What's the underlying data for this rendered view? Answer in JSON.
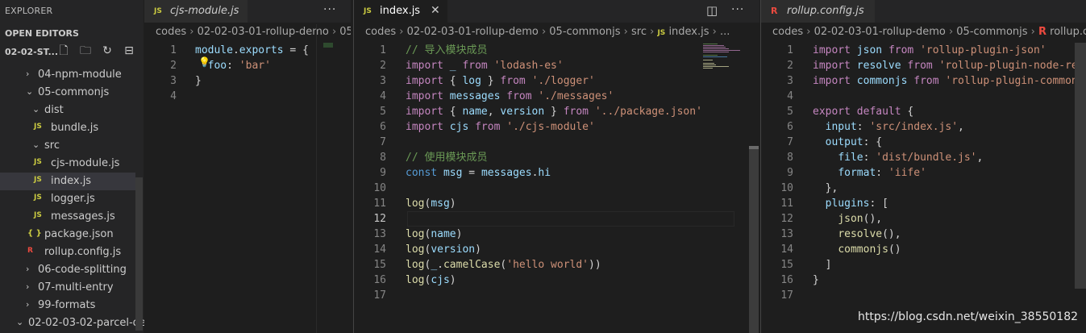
{
  "explorer": {
    "title": "EXPLORER",
    "more": "···",
    "open_editors": "OPEN EDITORS",
    "workspace": "02-02-ST...",
    "tree": [
      {
        "label": "04-npm-module",
        "type": "folder",
        "state": "collapsed",
        "depth": 1
      },
      {
        "label": "05-commonjs",
        "type": "folder",
        "state": "expanded",
        "depth": 1
      },
      {
        "label": "dist",
        "type": "folder",
        "state": "expanded",
        "depth": 2
      },
      {
        "label": "bundle.js",
        "type": "js",
        "depth": 3
      },
      {
        "label": "src",
        "type": "folder",
        "state": "expanded",
        "depth": 2
      },
      {
        "label": "cjs-module.js",
        "type": "js",
        "depth": 3
      },
      {
        "label": "index.js",
        "type": "js",
        "depth": 3,
        "selected": true
      },
      {
        "label": "logger.js",
        "type": "js",
        "depth": 3
      },
      {
        "label": "messages.js",
        "type": "js",
        "depth": 3
      },
      {
        "label": "package.json",
        "type": "json",
        "depth": 2
      },
      {
        "label": "rollup.config.js",
        "type": "rollup",
        "depth": 2
      },
      {
        "label": "06-code-splitting",
        "type": "folder",
        "state": "collapsed",
        "depth": 1
      },
      {
        "label": "07-multi-entry",
        "type": "folder",
        "state": "collapsed",
        "depth": 1
      },
      {
        "label": "99-formats",
        "type": "folder",
        "state": "collapsed",
        "depth": 1
      },
      {
        "label": "02-02-03-02-parcel-de...",
        "type": "folder",
        "state": "expanded",
        "depth": 0
      }
    ],
    "icons": {
      "js": "JS",
      "json": "{ }",
      "rollup": "R",
      "collapsed": "›",
      "expanded": "⌄"
    }
  },
  "editors": [
    {
      "tab": {
        "label": "cjs-module.js",
        "icon": "JS",
        "italic": true
      },
      "more": "···",
      "breadcrumb": [
        "codes",
        "02-02-03-01-rollup-demo",
        "05-cc"
      ],
      "lines": [
        [
          [
            "v",
            "module"
          ],
          [
            "p",
            "."
          ],
          [
            "v",
            "exports"
          ],
          [
            "p",
            " = {"
          ]
        ],
        [
          [
            "p",
            "  "
          ],
          [
            "v",
            "foo"
          ],
          [
            "p",
            ": "
          ],
          [
            "s",
            "'bar'"
          ]
        ],
        [
          [
            "p",
            "}"
          ]
        ],
        []
      ],
      "lightbulb": "💡"
    },
    {
      "tab": {
        "label": "index.js",
        "icon": "JS",
        "close": "✕",
        "active": true
      },
      "more": "···",
      "split": "◫",
      "breadcrumb": [
        "codes",
        "02-02-03-01-rollup-demo",
        "05-commonjs",
        "src",
        "JS",
        "index.js",
        "..."
      ],
      "lines": [
        [
          [
            "c",
            "// 导入模块成员"
          ]
        ],
        [
          [
            "k",
            "import"
          ],
          [
            "p",
            " "
          ],
          [
            "v",
            "_"
          ],
          [
            "p",
            " "
          ],
          [
            "k",
            "from"
          ],
          [
            "p",
            " "
          ],
          [
            "s",
            "'lodash-es'"
          ]
        ],
        [
          [
            "k",
            "import"
          ],
          [
            "p",
            " { "
          ],
          [
            "v",
            "log"
          ],
          [
            "p",
            " } "
          ],
          [
            "k",
            "from"
          ],
          [
            "p",
            " "
          ],
          [
            "s",
            "'./logger'"
          ]
        ],
        [
          [
            "k",
            "import"
          ],
          [
            "p",
            " "
          ],
          [
            "v",
            "messages"
          ],
          [
            "p",
            " "
          ],
          [
            "k",
            "from"
          ],
          [
            "p",
            " "
          ],
          [
            "s",
            "'./messages'"
          ]
        ],
        [
          [
            "k",
            "import"
          ],
          [
            "p",
            " { "
          ],
          [
            "v",
            "name"
          ],
          [
            "p",
            ", "
          ],
          [
            "v",
            "version"
          ],
          [
            "p",
            " } "
          ],
          [
            "k",
            "from"
          ],
          [
            "p",
            " "
          ],
          [
            "s",
            "'../package.json'"
          ]
        ],
        [
          [
            "k",
            "import"
          ],
          [
            "p",
            " "
          ],
          [
            "v",
            "cjs"
          ],
          [
            "p",
            " "
          ],
          [
            "k",
            "from"
          ],
          [
            "p",
            " "
          ],
          [
            "s",
            "'./cjs-module'"
          ]
        ],
        [],
        [
          [
            "c",
            "// 使用模块成员"
          ]
        ],
        [
          [
            "b",
            "const"
          ],
          [
            "p",
            " "
          ],
          [
            "v",
            "msg"
          ],
          [
            "p",
            " = "
          ],
          [
            "v",
            "messages"
          ],
          [
            "p",
            "."
          ],
          [
            "v",
            "hi"
          ]
        ],
        [],
        [
          [
            "f",
            "log"
          ],
          [
            "p",
            "("
          ],
          [
            "v",
            "msg"
          ],
          [
            "p",
            ")"
          ]
        ],
        [],
        [
          [
            "f",
            "log"
          ],
          [
            "p",
            "("
          ],
          [
            "v",
            "name"
          ],
          [
            "p",
            ")"
          ]
        ],
        [
          [
            "f",
            "log"
          ],
          [
            "p",
            "("
          ],
          [
            "v",
            "version"
          ],
          [
            "p",
            ")"
          ]
        ],
        [
          [
            "f",
            "log"
          ],
          [
            "p",
            "("
          ],
          [
            "v",
            "_"
          ],
          [
            "p",
            "."
          ],
          [
            "f",
            "camelCase"
          ],
          [
            "p",
            "("
          ],
          [
            "s",
            "'hello world'"
          ],
          [
            "p",
            "))"
          ]
        ],
        [
          [
            "f",
            "log"
          ],
          [
            "p",
            "("
          ],
          [
            "v",
            "cjs"
          ],
          [
            "p",
            ")"
          ]
        ],
        []
      ],
      "current_line": 12
    },
    {
      "tab": {
        "label": "rollup.config.js",
        "icon": "R",
        "italic": true
      },
      "breadcrumb": [
        "codes",
        "02-02-03-01-rollup-demo",
        "05-commonjs",
        "R",
        "rollup.conf"
      ],
      "lines": [
        [
          [
            "k",
            "import"
          ],
          [
            "p",
            " "
          ],
          [
            "v",
            "json"
          ],
          [
            "p",
            " "
          ],
          [
            "k",
            "from"
          ],
          [
            "p",
            " "
          ],
          [
            "s",
            "'rollup-plugin-json'"
          ]
        ],
        [
          [
            "k",
            "import"
          ],
          [
            "p",
            " "
          ],
          [
            "v",
            "resolve"
          ],
          [
            "p",
            " "
          ],
          [
            "k",
            "from"
          ],
          [
            "p",
            " "
          ],
          [
            "s",
            "'rollup-plugin-node-re"
          ]
        ],
        [
          [
            "k",
            "import"
          ],
          [
            "p",
            " "
          ],
          [
            "v",
            "commonjs"
          ],
          [
            "p",
            " "
          ],
          [
            "k",
            "from"
          ],
          [
            "p",
            " "
          ],
          [
            "s",
            "'rollup-plugin-common"
          ]
        ],
        [],
        [
          [
            "k",
            "export"
          ],
          [
            "p",
            " "
          ],
          [
            "k",
            "default"
          ],
          [
            "p",
            " {"
          ]
        ],
        [
          [
            "p",
            "  "
          ],
          [
            "v",
            "input"
          ],
          [
            "p",
            ": "
          ],
          [
            "s",
            "'src/index.js'"
          ],
          [
            "p",
            ","
          ]
        ],
        [
          [
            "p",
            "  "
          ],
          [
            "v",
            "output"
          ],
          [
            "p",
            ": {"
          ]
        ],
        [
          [
            "p",
            "    "
          ],
          [
            "v",
            "file"
          ],
          [
            "p",
            ": "
          ],
          [
            "s",
            "'dist/bundle.js'"
          ],
          [
            "p",
            ","
          ]
        ],
        [
          [
            "p",
            "    "
          ],
          [
            "v",
            "format"
          ],
          [
            "p",
            ": "
          ],
          [
            "s",
            "'iife'"
          ]
        ],
        [
          [
            "p",
            "  },"
          ]
        ],
        [
          [
            "p",
            "  "
          ],
          [
            "v",
            "plugins"
          ],
          [
            "p",
            ": ["
          ]
        ],
        [
          [
            "p",
            "    "
          ],
          [
            "f",
            "json"
          ],
          [
            "p",
            "(),"
          ]
        ],
        [
          [
            "p",
            "    "
          ],
          [
            "f",
            "resolve"
          ],
          [
            "p",
            "(),"
          ]
        ],
        [
          [
            "p",
            "    "
          ],
          [
            "f",
            "commonjs"
          ],
          [
            "p",
            "()"
          ]
        ],
        [
          [
            "p",
            "  ]"
          ]
        ],
        [
          [
            "p",
            "}"
          ]
        ],
        []
      ]
    }
  ],
  "watermark": "https://blog.csdn.net/weixin_38550182",
  "colors": {
    "bg": "#1e1e1e",
    "sidebar": "#252526",
    "keyword": "#c586c0",
    "string": "#ce9178",
    "variable": "#9cdcfe",
    "comment": "#6a9955",
    "function": "#dcdcaa",
    "js_icon": "#cbcb41",
    "rollup_icon": "#ec4a3f"
  }
}
